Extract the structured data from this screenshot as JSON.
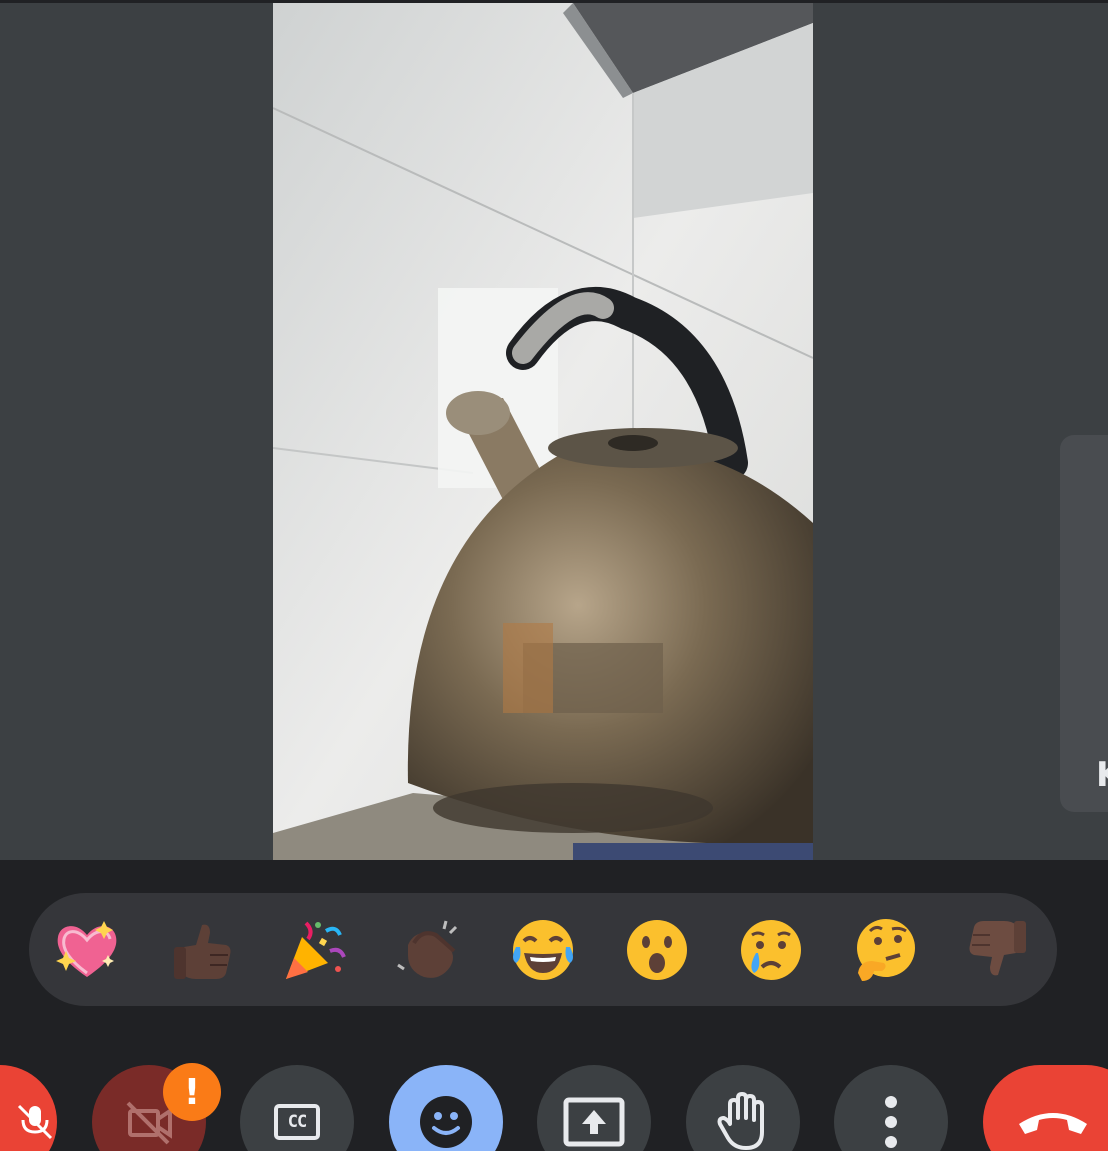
{
  "colors": {
    "background": "#3c4043",
    "bottom_bar": "#202124",
    "reaction_bar": "#35363a",
    "control_button": "#3c4043",
    "active_button": "#8ab4f8",
    "end_call": "#ea4335",
    "camera_off": "#7a2b28",
    "warning_badge": "#fa7b17"
  },
  "side_panel": {
    "label": "K"
  },
  "reactions": [
    {
      "icon": "sparkling-heart-icon",
      "label": "💖"
    },
    {
      "icon": "thumbs-up-icon",
      "label": "👍🏿"
    },
    {
      "icon": "party-popper-icon",
      "label": "🎉"
    },
    {
      "icon": "clapping-hands-icon",
      "label": "👏🏿"
    },
    {
      "icon": "tears-of-joy-icon",
      "label": "😂"
    },
    {
      "icon": "surprised-face-icon",
      "label": "😮"
    },
    {
      "icon": "crying-face-icon",
      "label": "😢"
    },
    {
      "icon": "thinking-face-icon",
      "label": "🤔"
    },
    {
      "icon": "thumbs-down-icon",
      "label": "👎🏿"
    }
  ],
  "controls": {
    "camera_warning_badge": "!",
    "buttons": [
      {
        "icon": "mic-off-icon"
      },
      {
        "icon": "camera-off-icon"
      },
      {
        "icon": "closed-captions-icon",
        "text": "CC"
      },
      {
        "icon": "emoji-icon"
      },
      {
        "icon": "present-screen-icon"
      },
      {
        "icon": "raise-hand-icon"
      },
      {
        "icon": "more-options-icon"
      },
      {
        "icon": "end-call-icon"
      }
    ]
  }
}
